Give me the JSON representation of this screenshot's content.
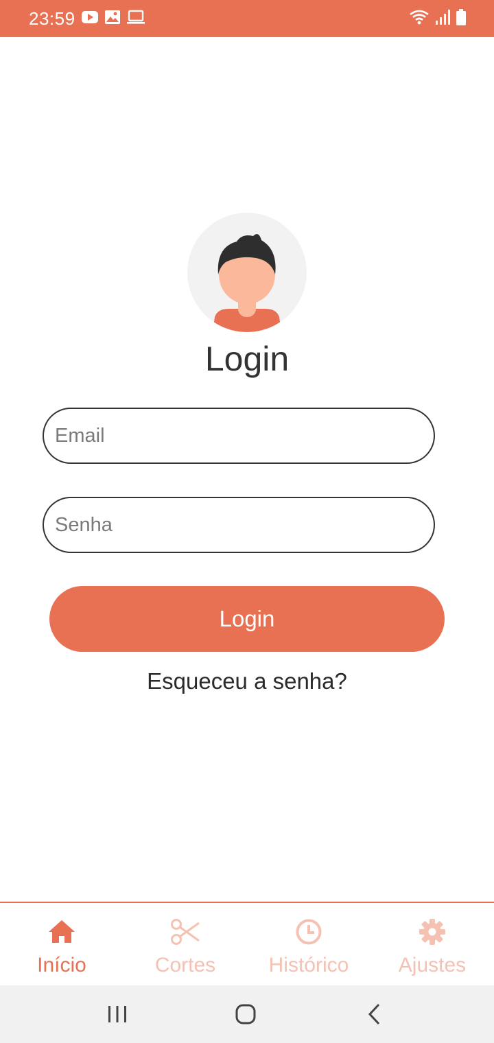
{
  "status_bar": {
    "time": "23:59",
    "left_icons": [
      "youtube-icon",
      "image-icon",
      "laptop-icon"
    ],
    "right_icons": [
      "wifi-icon",
      "signal-icon",
      "battery-icon"
    ]
  },
  "login": {
    "title": "Login",
    "email_placeholder": "Email",
    "password_placeholder": "Senha",
    "button_label": "Login",
    "forgot_label": "Esqueceu a senha?"
  },
  "bottom_nav": {
    "items": [
      {
        "label": "Início",
        "icon": "home-icon",
        "active": true
      },
      {
        "label": "Cortes",
        "icon": "scissors-icon",
        "active": false
      },
      {
        "label": "Histórico",
        "icon": "clock-icon",
        "active": false
      },
      {
        "label": "Ajustes",
        "icon": "gear-icon",
        "active": false
      }
    ]
  },
  "colors": {
    "accent": "#E87053",
    "accent_light": "#F4C1B3",
    "text": "#333333",
    "system_nav": "#F1F1F1"
  }
}
